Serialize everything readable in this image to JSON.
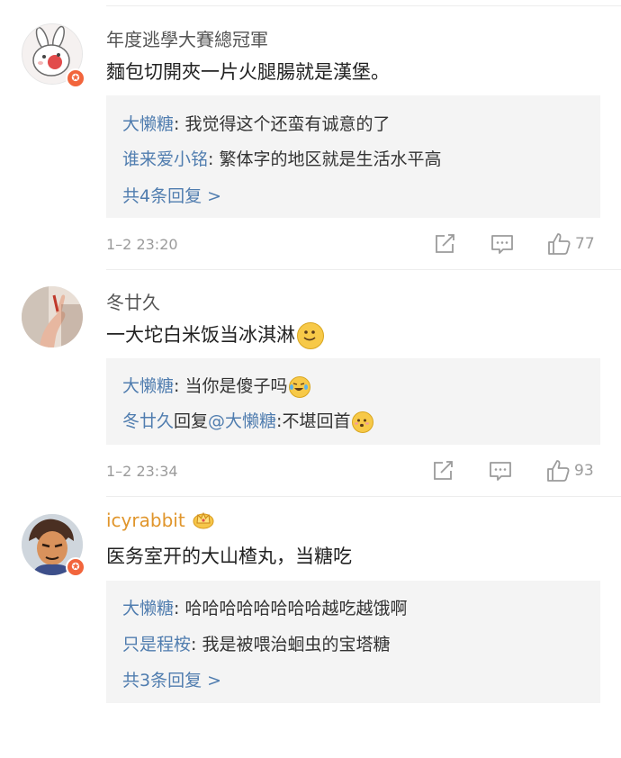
{
  "comments": [
    {
      "username": "年度逃學大賽總冠軍",
      "text": "麵包切開夾一片火腿腸就是漢堡。",
      "replies": [
        {
          "user": "大懒糖",
          "text": ": 我觉得这个还蛮有诚意的了"
        },
        {
          "user": "谁来爱小铭",
          "text": ": 繁体字的地区就是生活水平高"
        }
      ],
      "more": "共4条回复 >",
      "time": "1–2 23:20",
      "likes": "77"
    },
    {
      "username": "冬廿久",
      "text": "一大坨白米饭当冰淇淋",
      "replies": [
        {
          "user": "大懒糖",
          "text": ": 当你是傻子吗"
        },
        {
          "user": "冬廿久",
          "mid": "回复",
          "mention": "@大懒糖",
          "text": ":不堪回首"
        }
      ],
      "time": "1–2 23:34",
      "likes": "93"
    },
    {
      "username": "icyrabbit",
      "text": "医务室开的大山楂丸，当糖吃",
      "replies": [
        {
          "user": "大懒糖",
          "text": ": 哈哈哈哈哈哈哈哈越吃越饿啊"
        },
        {
          "user": "只是程桉",
          "text": ": 我是被喂治蛔虫的宝塔糖"
        }
      ],
      "more": "共3条回复 >"
    }
  ],
  "icons": [
    "verified-badge-icon",
    "share-icon",
    "comment-icon",
    "like-icon",
    "crown-icon",
    "smile-emoji-icon",
    "laugh-cry-emoji-icon",
    "awkward-emoji-icon"
  ],
  "colors": {
    "link": "#507daf",
    "meta": "#9b9b9b",
    "reply_bg": "#f4f4f4",
    "badge": "#f2653c",
    "gold_name": "#e0952b"
  }
}
